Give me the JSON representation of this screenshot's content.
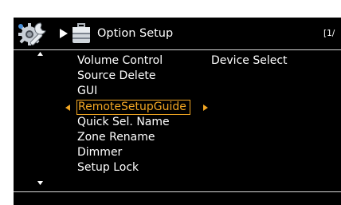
{
  "header": {
    "title": "Option Setup",
    "page_indicator": "[1/"
  },
  "menu": {
    "items": [
      {
        "label": "Volume Control"
      },
      {
        "label": "Source Delete"
      },
      {
        "label": "GUI"
      },
      {
        "label": "RemoteSetupGuide"
      },
      {
        "label": "Quick Sel. Name"
      },
      {
        "label": "Zone Rename"
      },
      {
        "label": "Dimmer"
      },
      {
        "label": "Setup Lock"
      }
    ],
    "selected_index": 3
  },
  "detail": {
    "option": "Device Select"
  },
  "icons": {
    "header_setup": "gear-wrench-icon",
    "breadcrumb_separator": "arrow-right-icon",
    "section": "case-icon",
    "scroll_up": "triangle-up-icon",
    "scroll_down": "triangle-down-icon",
    "selection_left": "triangle-left-icon",
    "selection_right": "triangle-right-icon"
  },
  "colors": {
    "background": "#000000",
    "text": "#ffffff",
    "accent": "#f2a623",
    "separator": "#d9d9d9"
  }
}
